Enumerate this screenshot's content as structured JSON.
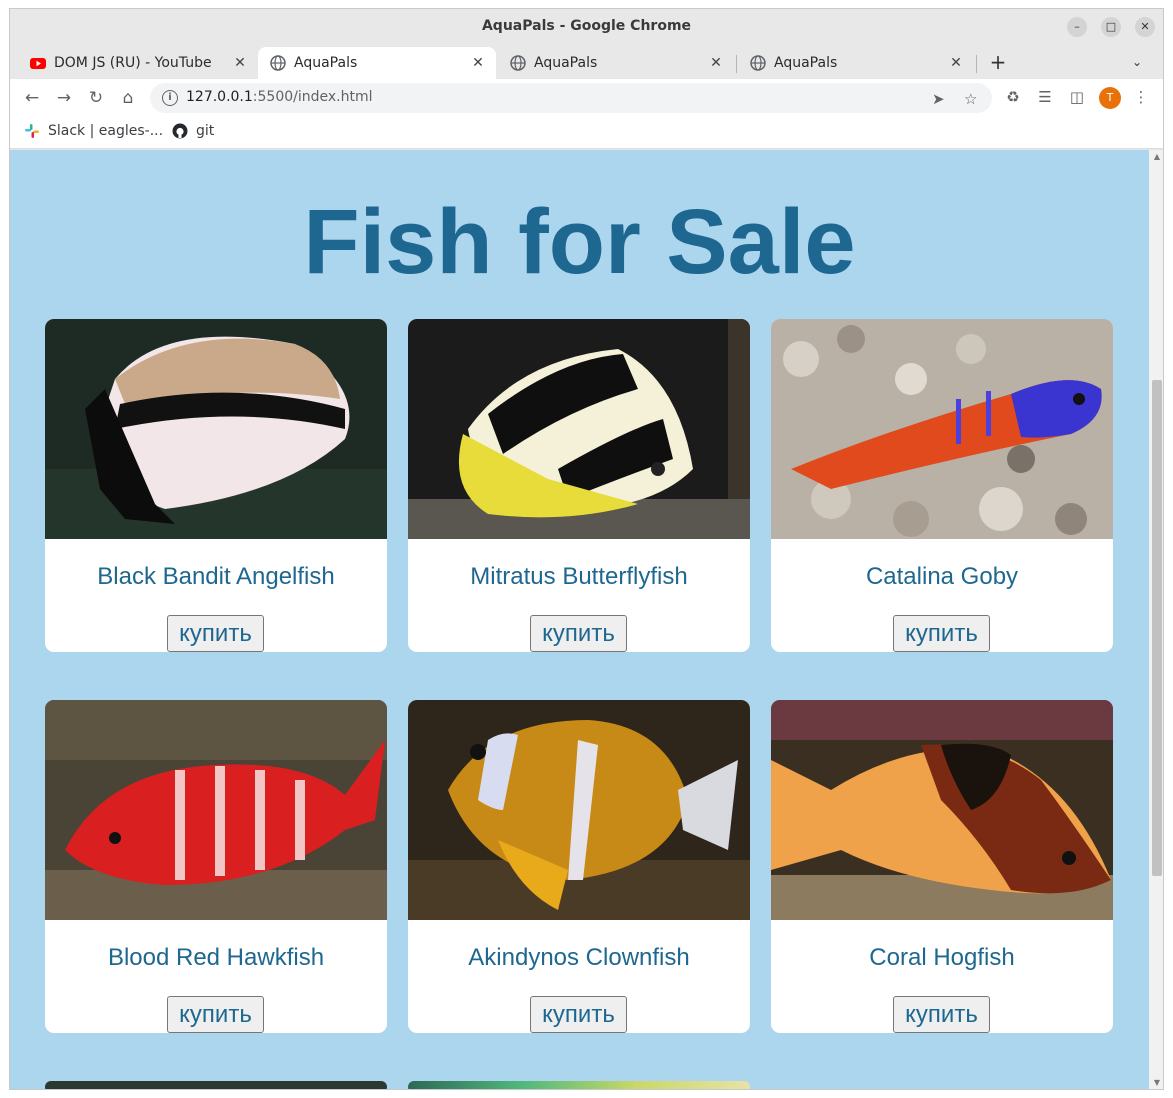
{
  "window": {
    "title": "AquaPals - Google Chrome"
  },
  "tabs": [
    {
      "label": "DOM JS (RU) - YouTube",
      "icon": "youtube-icon"
    },
    {
      "label": "AquaPals",
      "icon": "globe-icon",
      "active": true
    },
    {
      "label": "AquaPals",
      "icon": "globe-icon"
    },
    {
      "label": "AquaPals",
      "icon": "globe-icon"
    }
  ],
  "toolbar": {
    "url_host": "127.0.0.1",
    "url_rest": ":5500/index.html",
    "profile_initial": "T"
  },
  "bookmarks": [
    {
      "label": "Slack | eagles-...",
      "icon": "slack-icon"
    },
    {
      "label": "git",
      "icon": "github-icon"
    }
  ],
  "page": {
    "heading": "Fish for Sale",
    "buy_label": "купить",
    "fish": [
      {
        "name": "Black Bandit Angelfish"
      },
      {
        "name": "Mitratus Butterflyfish"
      },
      {
        "name": "Catalina Goby"
      },
      {
        "name": "Blood Red Hawkfish"
      },
      {
        "name": "Akindynos Clownfish"
      },
      {
        "name": "Coral Hogfish"
      }
    ]
  },
  "colors": {
    "page_background": "#acd5ee",
    "heading": "#1e6790",
    "card": "#ffffff",
    "profile": "#e8710a"
  }
}
